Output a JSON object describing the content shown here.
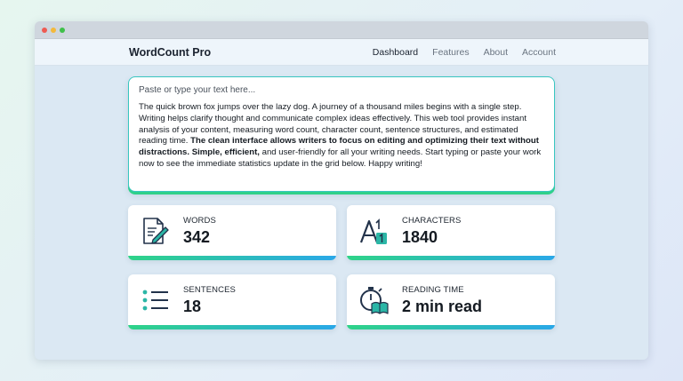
{
  "window": {
    "traffic_lights": [
      "red",
      "yellow",
      "green"
    ]
  },
  "navbar": {
    "brand": "WordCount Pro",
    "links": [
      "Dashboard",
      "Features",
      "About",
      "Account"
    ],
    "active": "Dashboard"
  },
  "editor": {
    "placeholder": "Paste or type your text here...",
    "text_plain_1": "The quick brown fox jumps over the lazy dog. A journey of a thousand miles begins with a single step. Writing helps clarify thought and communicate complex ideas effectively. This web tool provides instant analysis of your content, measuring word count, character count, sentence structures, and estimated reading time. ",
    "text_bold_1": "The clean interface allows writers to focus on editing and optimizing their text without distractions. Simple, efficient,",
    "text_plain_2": " and user-friendly for all your writing needs. Start typing or paste your work now to see the immediate statistics update in the grid below. Happy writing!"
  },
  "stats": {
    "words": {
      "label": "WORDS",
      "value": "342",
      "icon": "document-pencil-icon"
    },
    "characters": {
      "label": "CHARACTERS",
      "value": "1840",
      "icon": "letter-a-one-icon"
    },
    "sentences": {
      "label": "SENTENCES",
      "value": "18",
      "icon": "bullet-list-icon"
    },
    "reading_time": {
      "label": "READING TIME",
      "value": "2 min read",
      "icon": "stopwatch-book-icon"
    }
  },
  "colors": {
    "accent_green": "#2ed388",
    "accent_blue": "#2aa8e8",
    "icon_dark": "#22324a",
    "icon_teal": "#2bb6a6"
  }
}
